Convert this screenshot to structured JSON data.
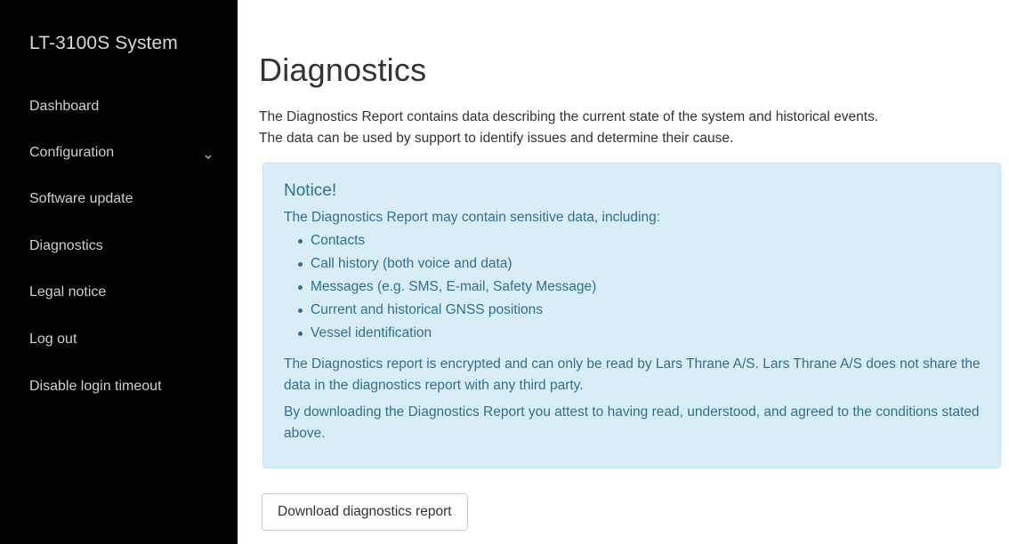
{
  "sidebar": {
    "brand": "LT-3100S System",
    "items": [
      {
        "label": "Dashboard"
      },
      {
        "label": "Configuration"
      },
      {
        "label": "Software update"
      },
      {
        "label": "Diagnostics"
      },
      {
        "label": "Legal notice"
      },
      {
        "label": "Log out"
      },
      {
        "label": "Disable login timeout"
      }
    ],
    "configuration_icon": "chevron-down-icon"
  },
  "main": {
    "title": "Diagnostics",
    "intro": [
      "The Diagnostics Report contains data describing the current state of the system and historical events.",
      "The data can be used by support to identify issues and determine their cause."
    ],
    "notice": {
      "title": "Notice!",
      "lead": "The Diagnostics Report may contain sensitive data, including:",
      "items": [
        "Contacts",
        "Call history (both voice and data)",
        "Messages (e.g. SMS, E-mail, Safety Message)",
        "Current and historical GNSS positions",
        "Vessel identification"
      ],
      "paragraph1": "The Diagnostics report is encrypted and can only be read by Lars Thrane A/S. Lars Thrane A/S does not share the data in the diagnostics report with any third party.",
      "paragraph2": "By downloading the Diagnostics Report you attest to having read, understood, and agreed to the conditions stated above."
    },
    "download_button": "Download diagnostics report"
  },
  "colors": {
    "sidebar_bg": "#000000",
    "alert_bg": "#d9edf7",
    "alert_text": "#31708f"
  }
}
